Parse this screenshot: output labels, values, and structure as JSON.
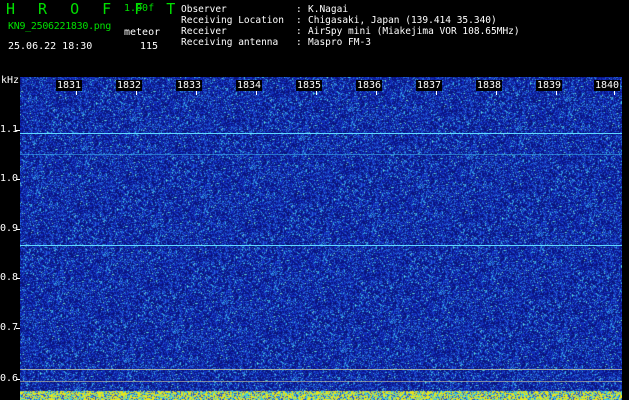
{
  "header": {
    "app_title": "H R O F F T",
    "version": "1.00f",
    "filename": "KN9_2506221830.png",
    "mode": "meteor",
    "timestamp": "25.06.22 18:30",
    "count": "115"
  },
  "metadata": [
    {
      "label": "Observer",
      "value": "K.Nagai"
    },
    {
      "label": "Receiving Location",
      "value": "Chigasaki, Japan (139.414 35.340)"
    },
    {
      "label": "Receiver",
      "value": "AirSpy mini (Miakejima VOR 108.65MHz)"
    },
    {
      "label": "Receiving antenna",
      "value": "Maspro FM-3"
    }
  ],
  "y_axis": {
    "unit": "kHz",
    "labels": [
      "1.1",
      "1.0",
      "0.9",
      "0.8",
      "0.7",
      "0.6"
    ]
  },
  "x_axis": {
    "labels": [
      "1831",
      "1832",
      "1833",
      "1834",
      "1835",
      "1836",
      "1837",
      "1838",
      "1839",
      "1840"
    ]
  },
  "colors": {
    "background": "#000000",
    "title_green": "#00e000",
    "waterfall_base": "#1a2fb0",
    "signal_line": "#30d0ff",
    "baseline_yellow": "#f0f000"
  }
}
